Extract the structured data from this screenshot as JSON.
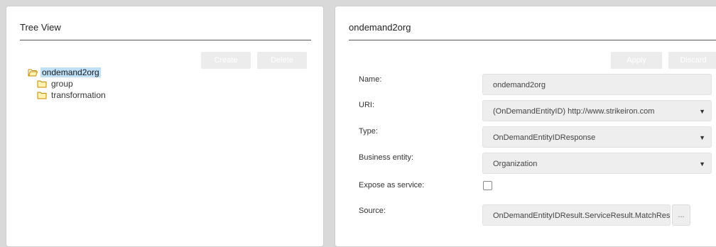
{
  "tree_panel": {
    "title": "Tree View",
    "create_label": "Create",
    "delete_label": "Delete",
    "root": {
      "label": "ondemand2org",
      "icon": "folder-open-icon",
      "selected": true
    },
    "children": [
      {
        "label": "group",
        "icon": "folder-icon"
      },
      {
        "label": "transformation",
        "icon": "folder-icon"
      }
    ]
  },
  "detail_panel": {
    "title": "ondemand2org",
    "apply_label": "Apply",
    "discard_label": "Discard",
    "fields": {
      "name": {
        "label": "Name:",
        "value": "ondemand2org"
      },
      "uri": {
        "label": "URI:",
        "value": "(OnDemandEntityID) http://www.strikeiron.com"
      },
      "type": {
        "label": "Type:",
        "value": "OnDemandEntityIDResponse"
      },
      "business_entity": {
        "label": "Business entity:",
        "value": "Organization"
      },
      "expose_as_service": {
        "label": "Expose as service:",
        "checked": false
      },
      "source": {
        "label": "Source:",
        "value": "OnDemandEntityIDResult.ServiceResult.MatchResponse.M",
        "browse_label": "..."
      }
    }
  },
  "colors": {
    "selection": "#bfe0f7",
    "disabled_button": "#ececec",
    "field_background": "#eeeeee"
  }
}
